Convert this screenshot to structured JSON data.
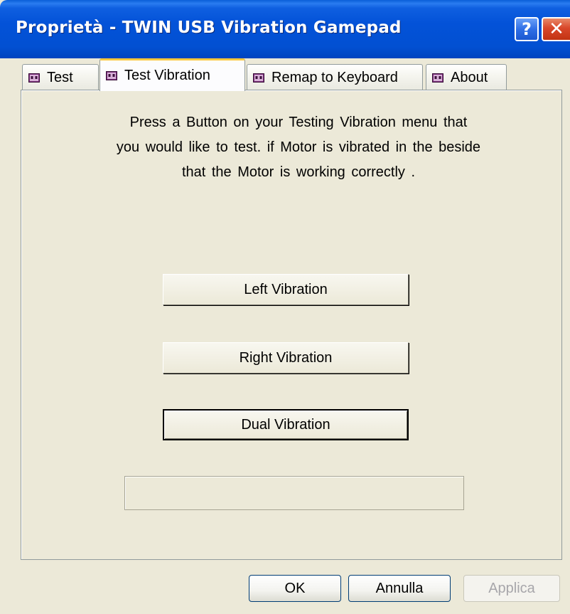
{
  "window": {
    "title": "Proprietà - TWIN USB Vibration Gamepad",
    "help_glyph": "?",
    "close_glyph": "✕"
  },
  "tabs": [
    {
      "label": "Test",
      "active": false,
      "icon": "gamepad-icon"
    },
    {
      "label": "Test Vibration",
      "active": true,
      "icon": "gamepad-icon"
    },
    {
      "label": "Remap to Keyboard",
      "active": false,
      "icon": "gamepad-icon"
    },
    {
      "label": "About",
      "active": false,
      "icon": "gamepad-icon"
    }
  ],
  "panel": {
    "instructions": [
      "Press a Button on your Testing Vibration menu that",
      "you would like to test. if Motor is vibrated in the beside",
      "that the Motor is working correctly ."
    ],
    "buttons": {
      "left": "Left Vibration",
      "right": "Right Vibration",
      "dual": "Dual Vibration"
    },
    "status_text": ""
  },
  "dialog_buttons": {
    "ok": "OK",
    "cancel": "Annulla",
    "apply": "Applica"
  },
  "colors": {
    "titlebar": "#0352d8",
    "active_tab_highlight": "#ffc83c",
    "window_bg": "#ece9d8",
    "close_button": "#d9472a",
    "disabled_text": "#a7a6aa"
  }
}
